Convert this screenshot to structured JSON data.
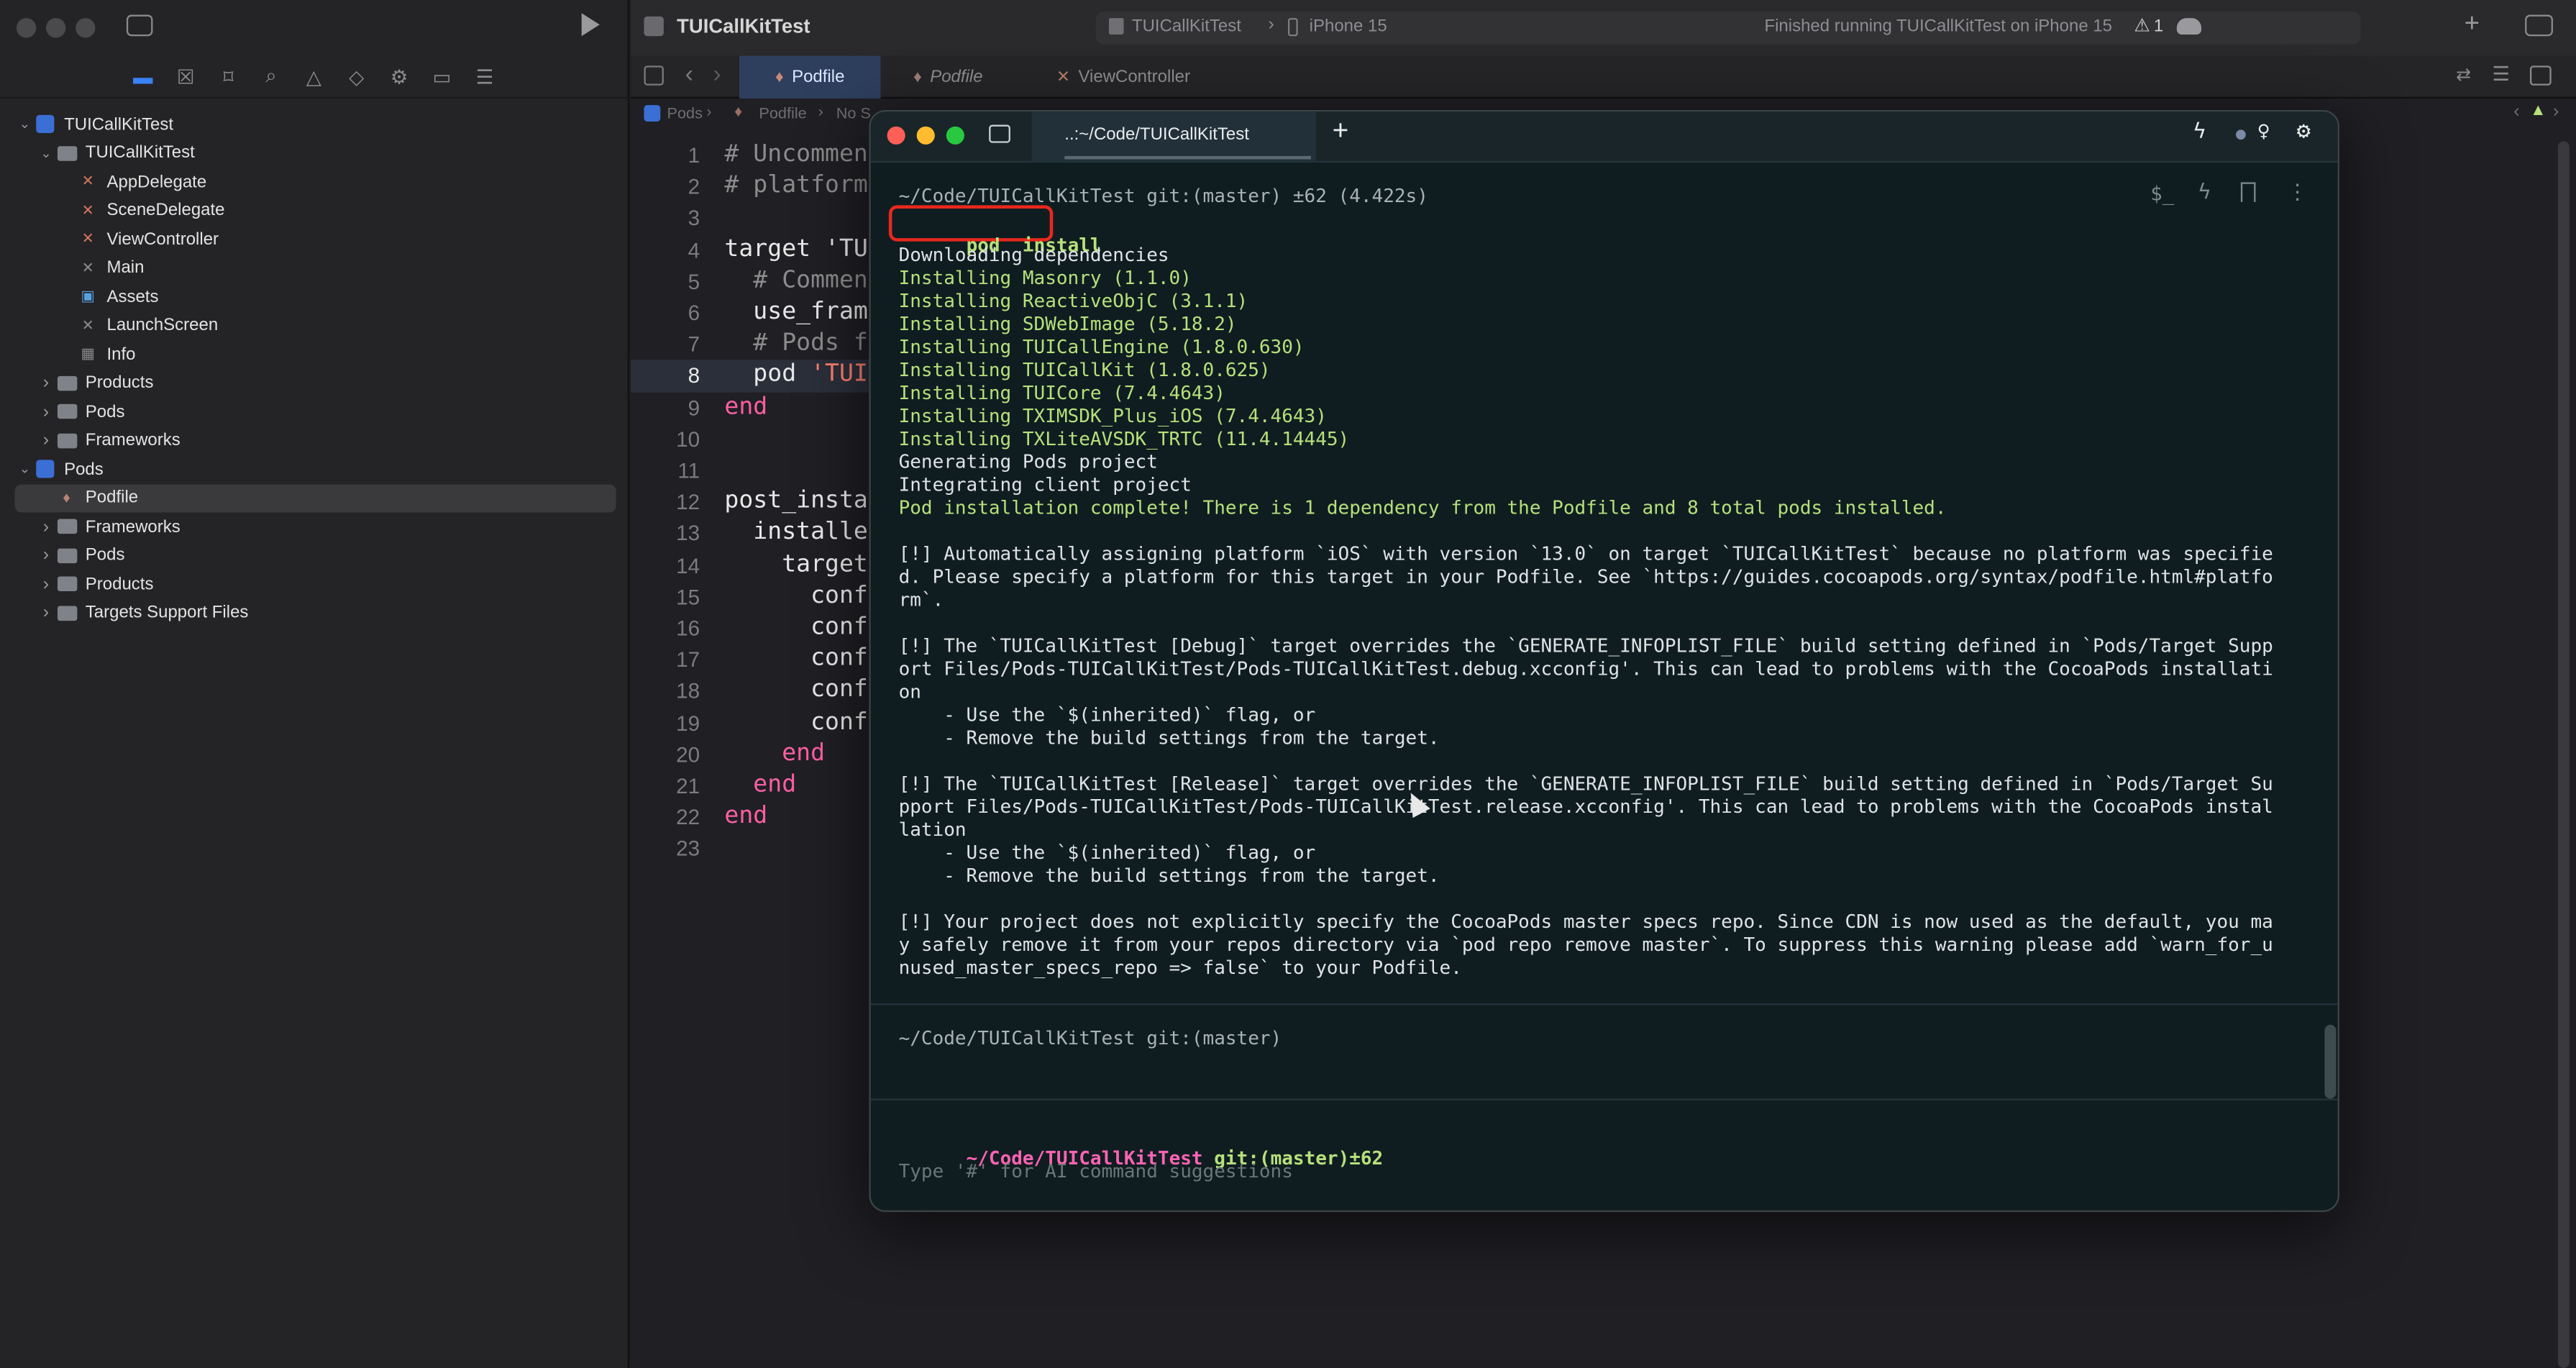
{
  "xcode": {
    "project_title": "TUICallKitTest",
    "scheme": "TUICallKitTest",
    "device": "iPhone 15",
    "status": "Finished running TUICallKitTest on iPhone 15",
    "warning_count": "1",
    "tabs": [
      {
        "label": "Podfile",
        "active": true
      },
      {
        "label": "Podfile",
        "active": false
      },
      {
        "label": "ViewController",
        "active": false
      }
    ],
    "jumpbar": [
      "Pods",
      "Podfile",
      "No S"
    ]
  },
  "navigator": {
    "rows": [
      {
        "label": "TUICallKitTest",
        "indent": 0,
        "disclosure": "open",
        "icon": "project-icon"
      },
      {
        "label": "TUICallKitTest",
        "indent": 1,
        "disclosure": "open",
        "icon": "folder-icon"
      },
      {
        "label": "AppDelegate",
        "indent": 2,
        "disclosure": "",
        "icon": "swift-file-icon"
      },
      {
        "label": "SceneDelegate",
        "indent": 2,
        "disclosure": "",
        "icon": "swift-file-icon"
      },
      {
        "label": "ViewController",
        "indent": 2,
        "disclosure": "",
        "icon": "swift-file-icon"
      },
      {
        "label": "Main",
        "indent": 2,
        "disclosure": "",
        "icon": "storyboard-icon"
      },
      {
        "label": "Assets",
        "indent": 2,
        "disclosure": "",
        "icon": "assets-icon"
      },
      {
        "label": "LaunchScreen",
        "indent": 2,
        "disclosure": "",
        "icon": "storyboard-icon"
      },
      {
        "label": "Info",
        "indent": 2,
        "disclosure": "",
        "icon": "plist-icon"
      },
      {
        "label": "Products",
        "indent": 1,
        "disclosure": "closed",
        "icon": "folder-icon"
      },
      {
        "label": "Pods",
        "indent": 1,
        "disclosure": "closed",
        "icon": "folder-icon"
      },
      {
        "label": "Frameworks",
        "indent": 1,
        "disclosure": "closed",
        "icon": "folder-icon"
      },
      {
        "label": "Pods",
        "indent": 0,
        "disclosure": "open",
        "icon": "project-icon"
      },
      {
        "label": "Podfile",
        "indent": 1,
        "disclosure": "",
        "icon": "ruby-file-icon",
        "selected": true
      },
      {
        "label": "Frameworks",
        "indent": 1,
        "disclosure": "closed",
        "icon": "folder-icon"
      },
      {
        "label": "Pods",
        "indent": 1,
        "disclosure": "closed",
        "icon": "folder-icon"
      },
      {
        "label": "Products",
        "indent": 1,
        "disclosure": "closed",
        "icon": "folder-icon"
      },
      {
        "label": "Targets Support Files",
        "indent": 1,
        "disclosure": "closed",
        "icon": "folder-icon"
      }
    ]
  },
  "code": {
    "current_line": "8",
    "lines": [
      {
        "n": "1",
        "segs": [
          {
            "t": "# Uncommen",
            "c": "#8c8c8c"
          }
        ]
      },
      {
        "n": "2",
        "segs": [
          {
            "t": "# platform",
            "c": "#8c8c8c"
          }
        ]
      },
      {
        "n": "3",
        "segs": []
      },
      {
        "n": "4",
        "segs": [
          {
            "t": "target 'TU",
            "c": "#e8e8e8"
          }
        ]
      },
      {
        "n": "5",
        "segs": [
          {
            "t": "  # Commen",
            "c": "#8c8c8c"
          }
        ]
      },
      {
        "n": "6",
        "segs": [
          {
            "t": "  use_fram",
            "c": "#e8e8e8"
          }
        ]
      },
      {
        "n": "7",
        "segs": [
          {
            "t": "  # Pods f",
            "c": "#8c8c8c"
          }
        ]
      },
      {
        "n": "8",
        "segs": [
          {
            "t": "  pod ",
            "c": "#e8e8e8"
          },
          {
            "t": "'TUI",
            "c": "#ff8170"
          }
        ]
      },
      {
        "n": "9",
        "segs": [
          {
            "t": "end",
            "c": "#fc5fa3"
          }
        ]
      },
      {
        "n": "10",
        "segs": []
      },
      {
        "n": "11",
        "segs": []
      },
      {
        "n": "12",
        "segs": [
          {
            "t": "post_insta",
            "c": "#e8e8e8"
          }
        ]
      },
      {
        "n": "13",
        "segs": [
          {
            "t": "  installe",
            "c": "#e8e8e8"
          }
        ]
      },
      {
        "n": "14",
        "segs": [
          {
            "t": "    target",
            "c": "#e8e8e8"
          }
        ]
      },
      {
        "n": "15",
        "segs": [
          {
            "t": "      conf",
            "c": "#e8e8e8"
          }
        ]
      },
      {
        "n": "16",
        "segs": [
          {
            "t": "      conf",
            "c": "#e8e8e8"
          }
        ]
      },
      {
        "n": "17",
        "segs": [
          {
            "t": "      conf",
            "c": "#e8e8e8"
          }
        ]
      },
      {
        "n": "18",
        "segs": [
          {
            "t": "      conf",
            "c": "#e8e8e8"
          }
        ]
      },
      {
        "n": "19",
        "segs": [
          {
            "t": "      conf",
            "c": "#e8e8e8"
          }
        ]
      },
      {
        "n": "20",
        "segs": [
          {
            "t": "    end",
            "c": "#fc5fa3"
          }
        ]
      },
      {
        "n": "21",
        "segs": [
          {
            "t": "  end",
            "c": "#fc5fa3"
          }
        ]
      },
      {
        "n": "22",
        "segs": [
          {
            "t": "end",
            "c": "#fc5fa3"
          }
        ]
      },
      {
        "n": "23",
        "segs": []
      }
    ]
  },
  "terminal": {
    "tab_title": "..:~/Code/TUICallKitTest",
    "new_tab_label": "+",
    "prompt_header": "~/Code/TUICallKitTest git:(master) ±62 (4.422s)",
    "command": "pod  install",
    "output_lines": [
      {
        "t": "Downloading dependencies",
        "c": "plain"
      },
      {
        "t": "Installing Masonry (1.1.0)",
        "c": "green"
      },
      {
        "t": "Installing ReactiveObjC (3.1.1)",
        "c": "green"
      },
      {
        "t": "Installing SDWebImage (5.18.2)",
        "c": "green"
      },
      {
        "t": "Installing TUICallEngine (1.8.0.630)",
        "c": "green"
      },
      {
        "t": "Installing TUICallKit (1.8.0.625)",
        "c": "green"
      },
      {
        "t": "Installing TUICore (7.4.4643)",
        "c": "green"
      },
      {
        "t": "Installing TXIMSDK_Plus_iOS (7.4.4643)",
        "c": "green"
      },
      {
        "t": "Installing TXLiteAVSDK_TRTC (11.4.14445)",
        "c": "green"
      },
      {
        "t": "Generating Pods project",
        "c": "plain"
      },
      {
        "t": "Integrating client project",
        "c": "plain"
      },
      {
        "t": "Pod installation complete! There is 1 dependency from the Podfile and 8 total pods installed.",
        "c": "green"
      },
      {
        "t": "",
        "c": "plain"
      },
      {
        "t": "[!] Automatically assigning platform `iOS` with version `13.0` on target `TUICallKitTest` because no platform was specifie",
        "c": "plain"
      },
      {
        "t": "d. Please specify a platform for this target in your Podfile. See `https://guides.cocoapods.org/syntax/podfile.html#platfo",
        "c": "plain"
      },
      {
        "t": "rm`.",
        "c": "plain"
      },
      {
        "t": "",
        "c": "plain"
      },
      {
        "t": "[!] The `TUICallKitTest [Debug]` target overrides the `GENERATE_INFOPLIST_FILE` build setting defined in `Pods/Target Supp",
        "c": "plain"
      },
      {
        "t": "ort Files/Pods-TUICallKitTest/Pods-TUICallKitTest.debug.xcconfig'. This can lead to problems with the CocoaPods installati",
        "c": "plain"
      },
      {
        "t": "on",
        "c": "plain"
      },
      {
        "t": "    - Use the `$(inherited)` flag, or",
        "c": "plain"
      },
      {
        "t": "    - Remove the build settings from the target.",
        "c": "plain"
      },
      {
        "t": "",
        "c": "plain"
      },
      {
        "t": "[!] The `TUICallKitTest [Release]` target overrides the `GENERATE_INFOPLIST_FILE` build setting defined in `Pods/Target Su",
        "c": "plain"
      },
      {
        "t": "pport Files/Pods-TUICallKitTest/Pods-TUICallKitTest.release.xcconfig'. This can lead to problems with the CocoaPods instal",
        "c": "plain"
      },
      {
        "t": "lation",
        "c": "plain"
      },
      {
        "t": "    - Use the `$(inherited)` flag, or",
        "c": "plain"
      },
      {
        "t": "    - Remove the build settings from the target.",
        "c": "plain"
      },
      {
        "t": "",
        "c": "plain"
      },
      {
        "t": "[!] Your project does not explicitly specify the CocoaPods master specs repo. Since CDN is now used as the default, you ma",
        "c": "plain"
      },
      {
        "t": "y safely remove it from your repos directory via `pod repo remove master`. To suppress this warning please add `warn_for_u",
        "c": "plain"
      },
      {
        "t": "nused_master_specs_repo => false` to your Podfile.",
        "c": "plain"
      }
    ],
    "second_prompt": "~/Code/TUICallKitTest git:(master)",
    "input_prompt_path": "~/Code/TUICallKitTest",
    "input_prompt_git": " git:(master)±62",
    "input_placeholder": "Type '#' for AI command suggestions"
  },
  "colors": {
    "highlight_box": "#e8281e",
    "terminal_bg": "#0f1d21",
    "accent": "#3b82f6"
  }
}
